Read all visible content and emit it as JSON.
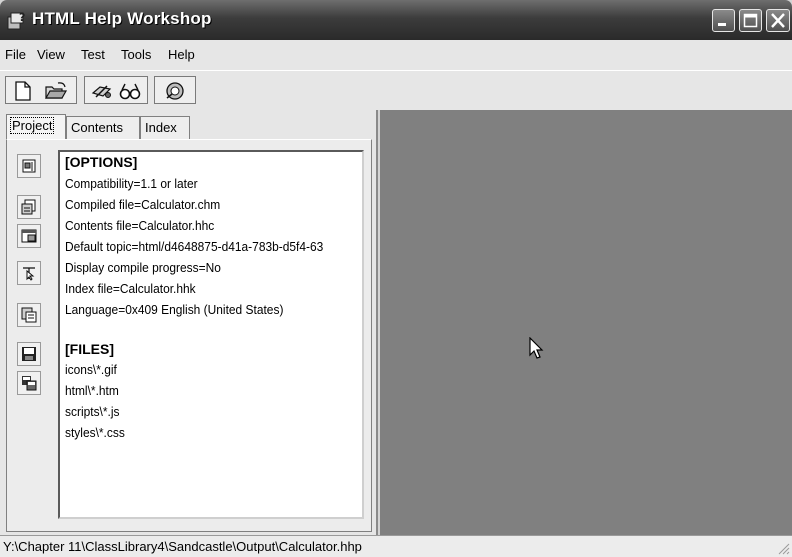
{
  "window": {
    "title": "HTML Help Workshop",
    "controls": {
      "minimize_icon": "minimize-icon",
      "maximize_icon": "maximize-icon",
      "close_icon": "close-icon"
    }
  },
  "menu": {
    "items": [
      {
        "label": "File"
      },
      {
        "label": "View"
      },
      {
        "label": "Test"
      },
      {
        "label": "Tools"
      },
      {
        "label": "Help"
      }
    ]
  },
  "toolbar": {
    "buttons": [
      {
        "icon": "new-file-icon"
      },
      {
        "icon": "open-folder-icon"
      },
      {
        "icon": "compile-icon"
      },
      {
        "icon": "view-compiled-icon"
      },
      {
        "icon": "help-icon"
      }
    ]
  },
  "tabs": [
    {
      "label": "Project",
      "active": true
    },
    {
      "label": "Contents",
      "active": false
    },
    {
      "label": "Index",
      "active": false
    }
  ],
  "side_buttons": [
    {
      "icon": "change-options-icon"
    },
    {
      "icon": "add-remove-files-icon"
    },
    {
      "icon": "window-types-icon"
    },
    {
      "icon": "map-icon"
    },
    {
      "icon": "alias-icon"
    },
    {
      "icon": "save-icon"
    },
    {
      "icon": "save-compile-icon"
    }
  ],
  "project": {
    "options_header": "[OPTIONS]",
    "options": [
      "Compatibility=1.1 or later",
      "Compiled file=Calculator.chm",
      "Contents file=Calculator.hhc",
      "Default topic=html/d4648875-d41a-783b-d5f4-63",
      "Display compile progress=No",
      "Index file=Calculator.hhk",
      "Language=0x409 English (United States)"
    ],
    "files_header": "[FILES]",
    "files": [
      "icons\\*.gif",
      "html\\*.htm",
      "scripts\\*.js",
      "styles\\*.css"
    ]
  },
  "status": {
    "path": "Y:\\Chapter 11\\ClassLibrary4\\Sandcastle\\Output\\Calculator.hhp"
  }
}
